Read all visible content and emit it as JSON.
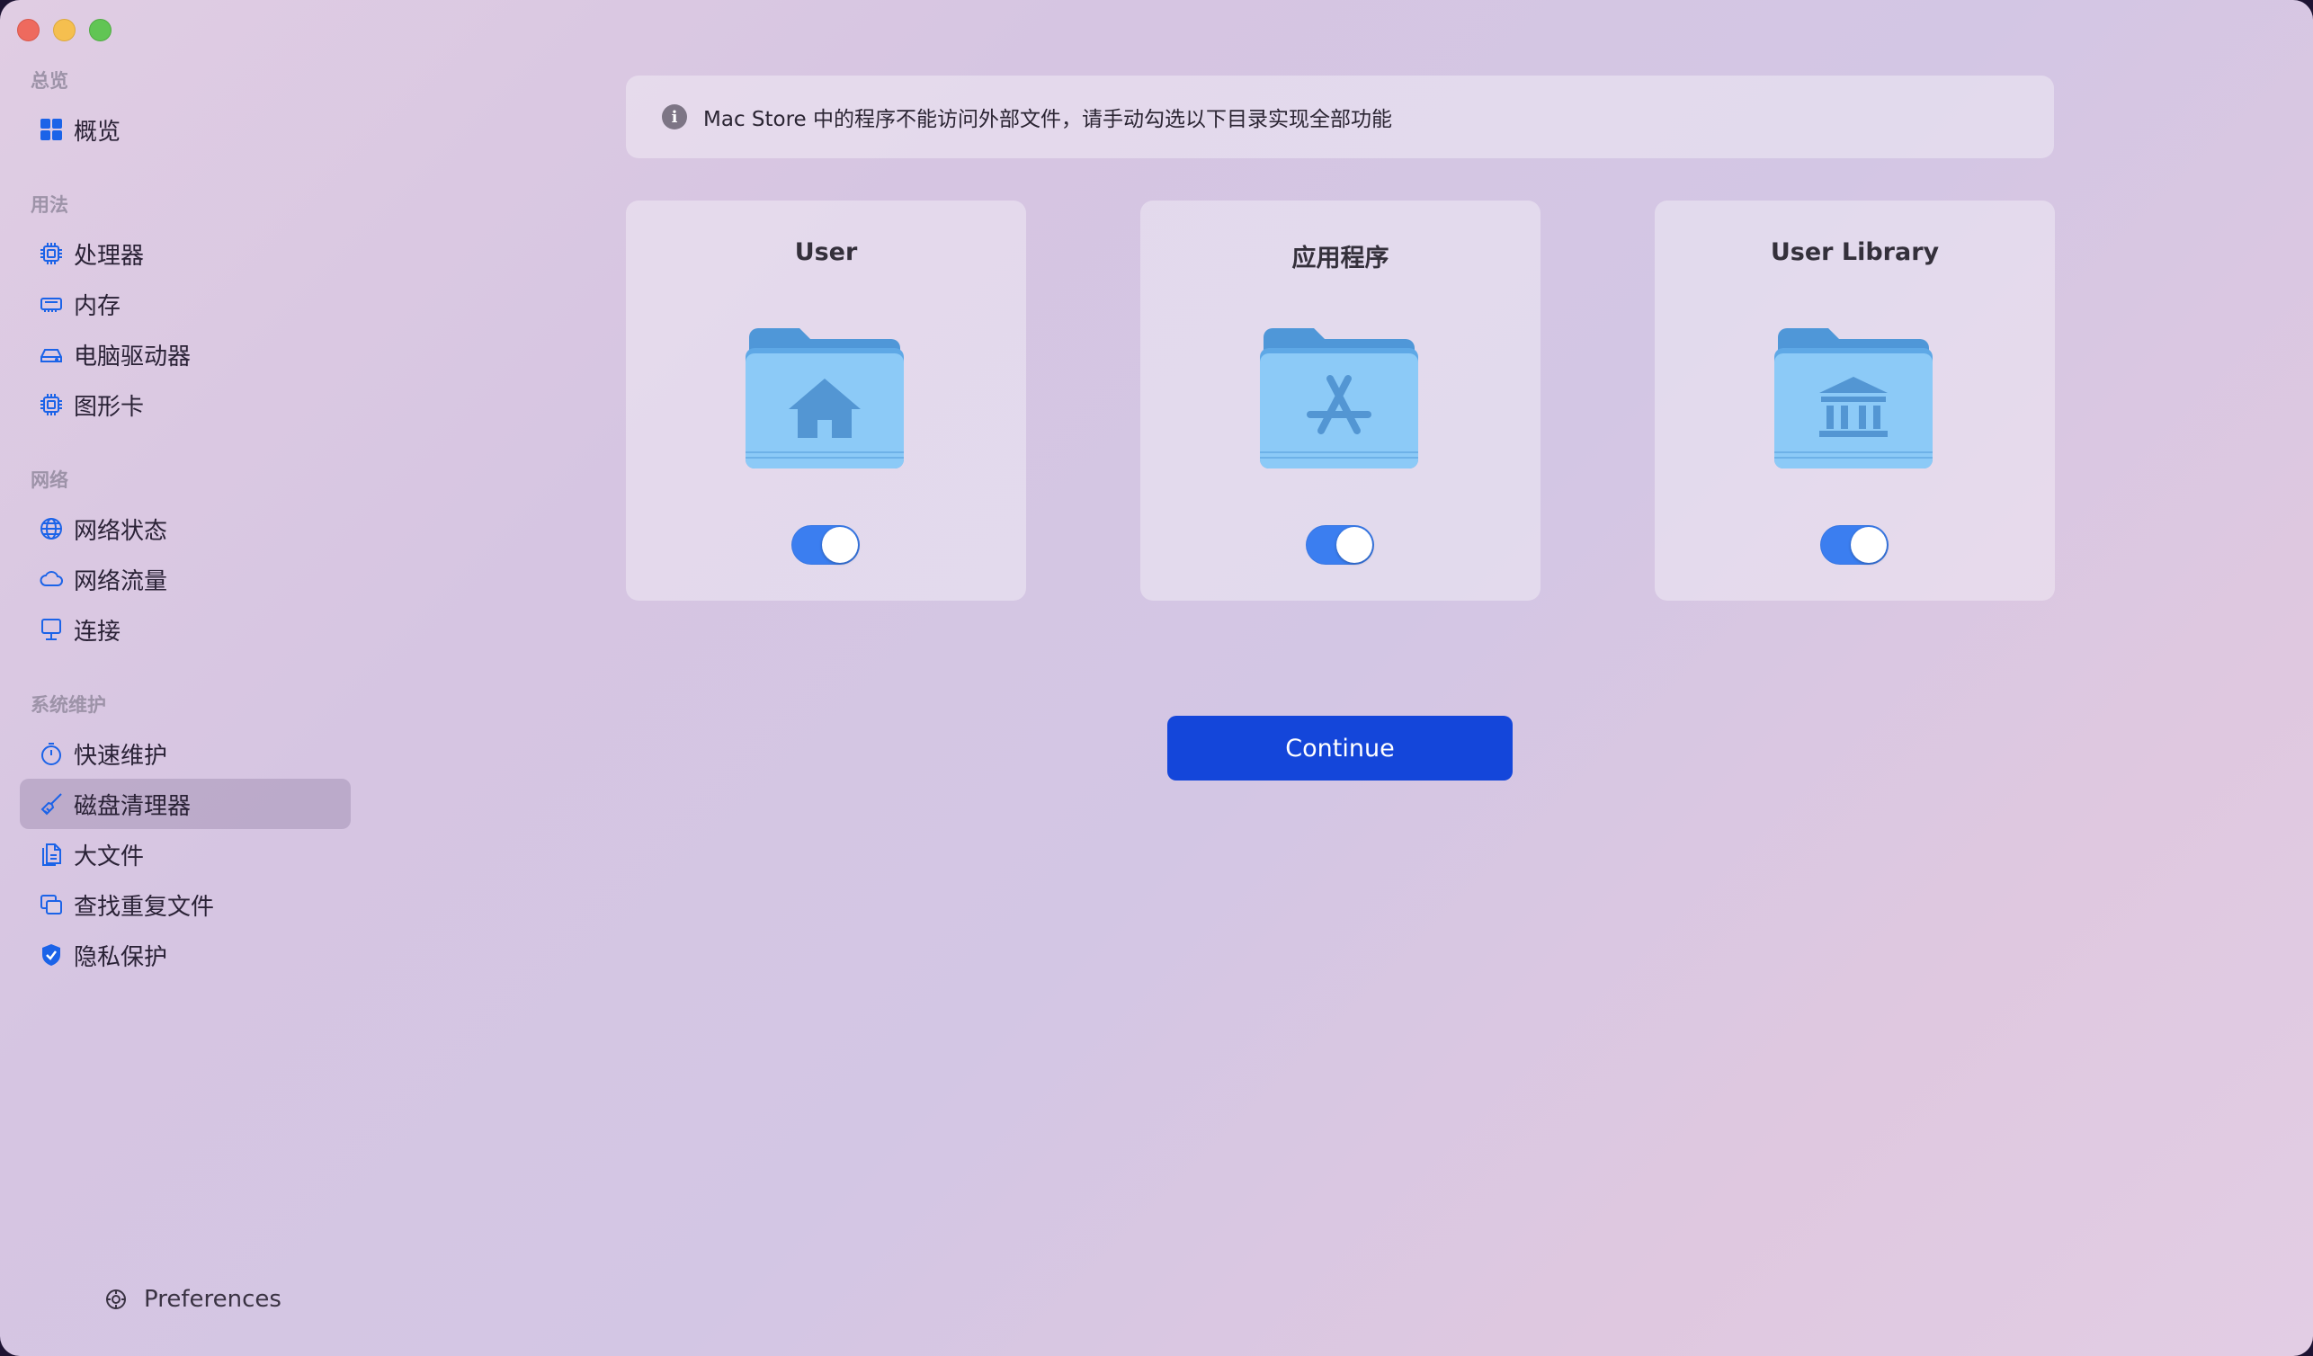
{
  "sidebar": {
    "sections": [
      {
        "header": "总览",
        "items": [
          {
            "label": "概览",
            "icon": "grid-icon"
          }
        ]
      },
      {
        "header": "用法",
        "items": [
          {
            "label": "处理器",
            "icon": "cpu-icon"
          },
          {
            "label": "内存",
            "icon": "memory-icon"
          },
          {
            "label": "电脑驱动器",
            "icon": "drive-icon"
          },
          {
            "label": "图形卡",
            "icon": "gpu-icon"
          }
        ]
      },
      {
        "header": "网络",
        "items": [
          {
            "label": "网络状态",
            "icon": "globe-icon"
          },
          {
            "label": "网络流量",
            "icon": "cloud-icon"
          },
          {
            "label": "连接",
            "icon": "desktop-icon"
          }
        ]
      },
      {
        "header": "系统维护",
        "items": [
          {
            "label": "快速维护",
            "icon": "timer-icon"
          },
          {
            "label": "磁盘清理器",
            "icon": "broom-icon",
            "selected": true
          },
          {
            "label": "大文件",
            "icon": "documents-icon"
          },
          {
            "label": "查找重复文件",
            "icon": "duplicate-icon"
          },
          {
            "label": "隐私保护",
            "icon": "shield-icon"
          }
        ]
      }
    ],
    "preferences_label": "Preferences"
  },
  "main": {
    "notice": "Mac Store 中的程序不能访问外部文件，请手动勾选以下目录实现全部功能",
    "folders": [
      {
        "title": "User",
        "icon": "home-folder-icon",
        "enabled": true
      },
      {
        "title": "应用程序",
        "icon": "applications-folder-icon",
        "enabled": true
      },
      {
        "title": "User Library",
        "icon": "library-folder-icon",
        "enabled": true
      }
    ],
    "continue_label": "Continue"
  },
  "colors": {
    "accent": "#1446da",
    "toggle_on": "#3b7ef0",
    "icon_blue": "#1b63e8"
  }
}
